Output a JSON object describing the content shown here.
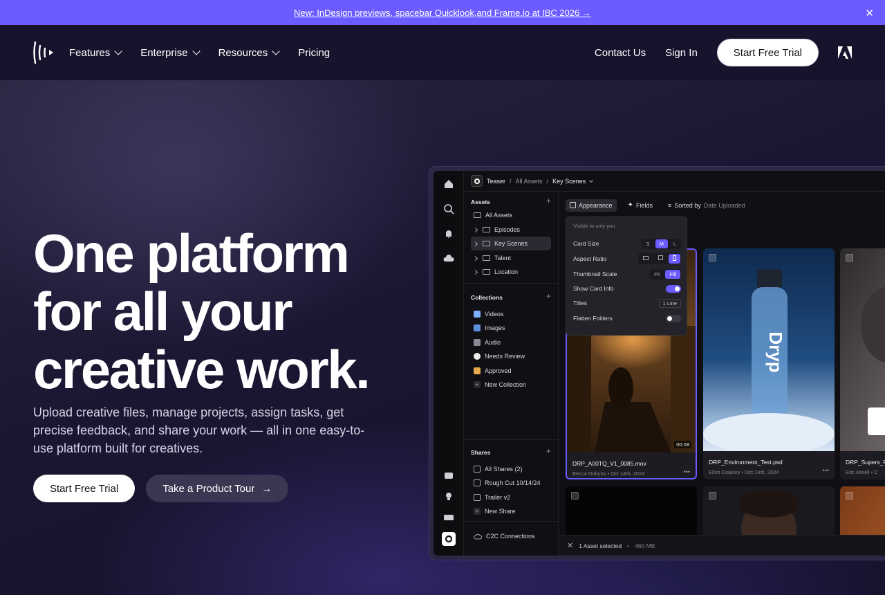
{
  "announcement": {
    "text": "New: InDesign previews, spacebar Quicklook,and Frame.io at IBC 2026 →",
    "close": "✕"
  },
  "nav": {
    "items": [
      "Features",
      "Enterprise",
      "Resources",
      "Pricing"
    ],
    "contact": "Contact Us",
    "signin": "Sign In",
    "cta": "Start Free Trial"
  },
  "hero": {
    "headline": "One platform for all your creative work.",
    "subtext": "Upload creative files, manage projects, assign tasks, get precise feedback, and share your work — all in one easy-to-use platform built for creatives.",
    "cta_primary": "Start Free Trial",
    "cta_secondary": "Take a Product Tour",
    "cta_arrow": "→"
  },
  "app": {
    "breadcrumb": {
      "project": "Teaser",
      "sep": "/",
      "mid": "All Assets",
      "current": "Key Scenes"
    },
    "sidebar": {
      "assets_head": "Assets",
      "assets": [
        "All Assets",
        "Episodes",
        "Key Scenes",
        "Talent",
        "Location"
      ],
      "collections_head": "Collections",
      "collections": [
        "Videos",
        "Images",
        "Audio",
        "Needs Review",
        "Approved",
        "New Collection"
      ],
      "shares_head": "Shares",
      "shares": [
        "All Shares (2)",
        "Rough Cut 10/14/24",
        "Trailer v2",
        "New Share"
      ],
      "c2c": "C2C Connections",
      "plus": "+"
    },
    "toolbar": {
      "appearance": "Appearance",
      "fields": "Fields",
      "sorted_prefix": "Sorted by",
      "sorted_value": "Date Uploaded"
    },
    "popover": {
      "note": "Visible to only you",
      "card_size": "Card Size",
      "sizes": [
        "S",
        "M",
        "L"
      ],
      "aspect_ratio": "Aspect Ratio",
      "thumbnail_scale": "Thumbnail Scale",
      "scales": [
        "Fit",
        "Fill"
      ],
      "show_card_info": "Show Card Info",
      "titles": "Titles",
      "titles_value": "1 Line",
      "flatten_folders": "Flatten Folders"
    },
    "cards": [
      {
        "title": "DRP_A00TQ_V1_0085.mov",
        "author": "Becca Dobyns",
        "date": "Oct 14th, 2024",
        "duration": "00:08"
      },
      {
        "title": "DRP_Environment_Test.psd",
        "author": "Elliot Coakley",
        "date": "Oct 14th, 2024"
      },
      {
        "title": "DRP_Supers_F",
        "author": "Eric Atwell",
        "date": "C"
      }
    ],
    "bottle_text": "Dryp",
    "dot": "•",
    "more": "•••",
    "status": {
      "selected": "1 Asset selected",
      "size": "460 MB"
    }
  },
  "colors": {
    "accent": "#6a5cff",
    "bg": "#15122b"
  }
}
